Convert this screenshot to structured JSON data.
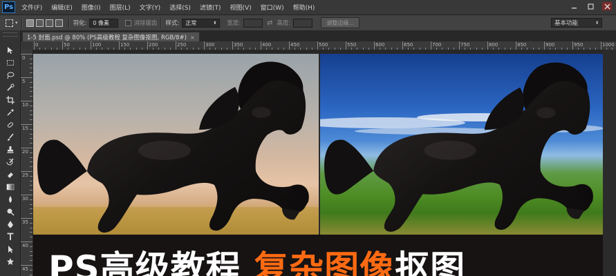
{
  "app": {
    "logo_text": "Ps",
    "menus": [
      "文件(F)",
      "编辑(E)",
      "图像(I)",
      "图层(L)",
      "文字(Y)",
      "选择(S)",
      "滤镜(T)",
      "视图(V)",
      "窗口(W)",
      "帮助(H)"
    ],
    "window_controls": [
      "minimize-icon",
      "maximize-icon",
      "close-icon"
    ]
  },
  "options_bar": {
    "feather_label": "羽化:",
    "feather_value": "0 像素",
    "antialias_label": "消除锯齿",
    "style_label": "样式:",
    "style_value": "正常",
    "width_label": "宽度:",
    "height_label": "高度:",
    "refine_edge_button": "调整边缘...",
    "workspace_value": "基本功能"
  },
  "document": {
    "tab_title": "1-5 封面.psd @ 80% (PS高级教程 复杂图像抠图, RGB/8#)",
    "tab_close": "×"
  },
  "rulers": {
    "horizontal_labels": [
      "0",
      "50",
      "100",
      "150",
      "200",
      "250",
      "300",
      "350",
      "400",
      "450",
      "500",
      "550",
      "600",
      "650",
      "700",
      "750",
      "800",
      "850",
      "900",
      "950",
      "1000"
    ],
    "vertical_labels": [
      "0",
      "5",
      "10",
      "15",
      "20",
      "25",
      "30",
      "35",
      "40",
      "45"
    ]
  },
  "tools": [
    "move-tool-icon",
    "marquee-tool-icon",
    "lasso-tool-icon",
    "quick-select-tool-icon",
    "crop-tool-icon",
    "eyedropper-tool-icon",
    "healing-brush-icon",
    "brush-tool-icon",
    "clone-stamp-icon",
    "history-brush-icon",
    "eraser-tool-icon",
    "gradient-tool-icon",
    "blur-tool-icon",
    "dodge-tool-icon",
    "pen-tool-icon",
    "type-tool-icon",
    "path-select-icon",
    "shape-tool-icon"
  ],
  "canvas": {
    "banner_white_1": "PS高级教程 ",
    "banner_orange": "复杂图像",
    "banner_white_2": "抠图"
  },
  "colors": {
    "accent_orange": "#ff6a12",
    "ps_blue": "#2b79c2",
    "panel_bg": "#424242"
  }
}
